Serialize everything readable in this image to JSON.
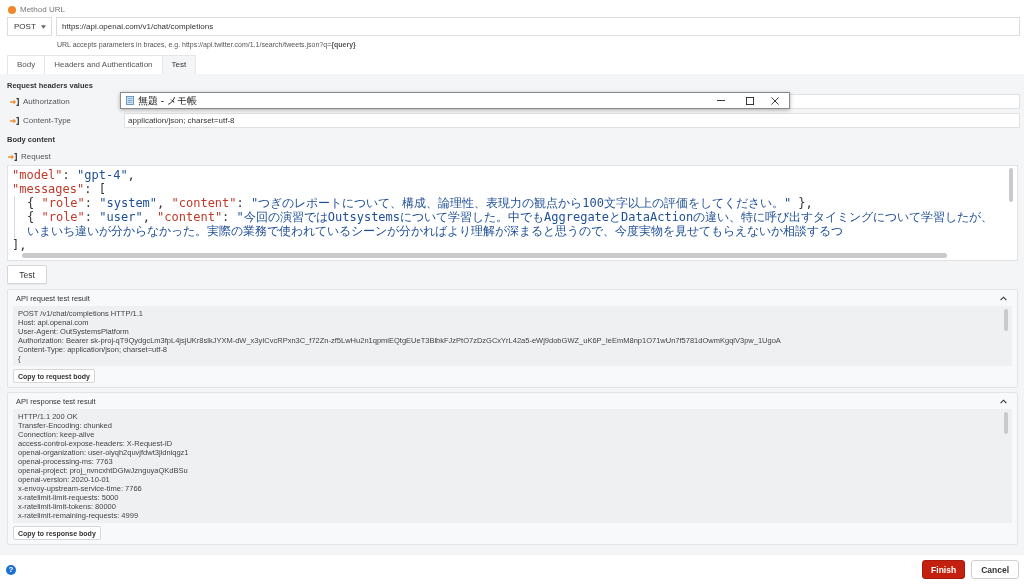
{
  "method_url": {
    "label": "Method URL",
    "method": "POST",
    "url": "https://api.openai.com/v1/chat/completions",
    "hint": "URL accepts parameters in braces, e.g. https://api.twitter.com/1.1/search/tweets.json?q=**{query}**"
  },
  "tabs": [
    {
      "label": "Body",
      "selected": false
    },
    {
      "label": "Headers and Authentication",
      "selected": false
    },
    {
      "label": "Test",
      "selected": true
    }
  ],
  "request_headers": {
    "title": "Request headers values",
    "headers": [
      {
        "name": "Authorization"
      },
      {
        "name": "Content-Type",
        "value": "application/json; charset=utf-8"
      }
    ]
  },
  "notepad_window": {
    "title": "無題 - メモ帳"
  },
  "body_content": {
    "title": "Body content",
    "label": "Request",
    "lines": [
      {
        "tokens": [
          {
            "kind": "key",
            "text": "\"model\""
          },
          {
            "kind": "punct",
            "text": ": "
          },
          {
            "kind": "string",
            "text": "\"gpt-4\""
          },
          {
            "kind": "punct",
            "text": ","
          }
        ]
      },
      {
        "tokens": [
          {
            "kind": "key",
            "text": "\"messages\""
          },
          {
            "kind": "punct",
            "text": ": ["
          }
        ],
        "children": [
          {
            "tokens": [
              {
                "kind": "punct",
                "text": "{ "
              },
              {
                "kind": "key",
                "text": "\"role\""
              },
              {
                "kind": "punct",
                "text": ": "
              },
              {
                "kind": "string",
                "text": "\"system\""
              },
              {
                "kind": "punct",
                "text": ", "
              },
              {
                "kind": "key",
                "text": "\"content\""
              },
              {
                "kind": "punct",
                "text": ": "
              },
              {
                "kind": "string",
                "text": "\"つぎのレポートについて、構成、論理性、表現力の観点から100文字以上の評価をしてください。\""
              },
              {
                "kind": "punct",
                "text": " },"
              }
            ]
          },
          {
            "tokens": [
              {
                "kind": "punct",
                "text": "{ "
              },
              {
                "kind": "key",
                "text": "\"role\""
              },
              {
                "kind": "punct",
                "text": ": "
              },
              {
                "kind": "string",
                "text": "\"user\""
              },
              {
                "kind": "punct",
                "text": ", "
              },
              {
                "kind": "key",
                "text": "\"content\""
              },
              {
                "kind": "punct",
                "text": ": "
              },
              {
                "kind": "string",
                "text": "\"今回の演習ではOutsystemsについて学習した。中でもAggregateとDataActionの違い、特に呼び出すタイミングについて学習したが、いまいち違いが分からなかった。実際の業務で使われているシーンが分かればより理解が深まると思うので、今度実物を見せてもらえないか相談するつ"
              }
            ]
          }
        ]
      },
      {
        "tokens": [
          {
            "kind": "punct",
            "text": "],"
          }
        ]
      }
    ]
  },
  "test_button": {
    "label": "Test"
  },
  "request_result": {
    "title": "API request test result",
    "expanded": true,
    "lines": [
      "POST /v1/chat/completions HTTP/1.1",
      "Host: api.openai.com",
      "User-Agent: OutSystemsPlatform",
      "Authorization: Bearer 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",
      "Content-Type: application/json; charset=utf-8",
      "{"
    ],
    "button": "Copy to request body"
  },
  "response_result": {
    "title": "API response test result",
    "expanded": true,
    "lines": [
      "HTTP/1.1 200 OK",
      "Transfer-Encoding: chunked",
      "Connection: keep-alive",
      "access-control-expose-headers: X-Request-ID",
      "openai-organization: user-oiyqh2quvjfdwt3jidniqgz1",
      "openai-processing-ms: 7763",
      "openai-project: proj_nvncxhtDGlwJznguyaQKdBSu",
      "openai-version: 2020-10-01",
      "x-envoy-upstream-service-time: 7766",
      "x-ratelimit-limit-requests: 5000",
      "x-ratelimit-limit-tokens: 80000",
      "x-ratelimit-remaining-requests: 4999"
    ],
    "button": "Copy to response body"
  },
  "footer": {
    "help": "?",
    "buttons": [
      {
        "label": "Finish",
        "kind": "primary"
      },
      {
        "label": "Cancel",
        "kind": "secondary"
      }
    ]
  }
}
